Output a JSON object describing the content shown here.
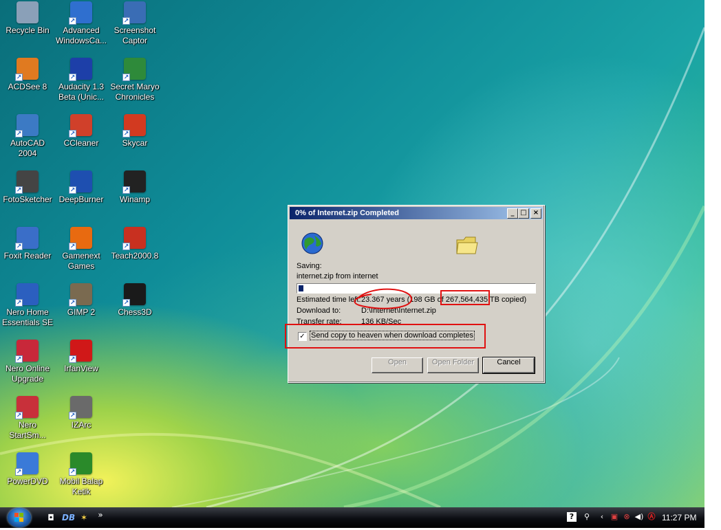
{
  "desktop_icons": [
    {
      "label": "Recycle Bin",
      "icon": "recycle-bin-icon",
      "color": "#8aa0b8"
    },
    {
      "label": "Advanced WindowsCa...",
      "icon": "advanced-windowscare-icon",
      "color": "#2f6fcf"
    },
    {
      "label": "Screenshot Captor",
      "icon": "screenshot-captor-icon",
      "color": "#3a6db5"
    },
    {
      "label": "ACDSee 8",
      "icon": "acdsee-icon",
      "color": "#e07a20"
    },
    {
      "label": "Audacity 1.3 Beta (Unic...",
      "icon": "audacity-icon",
      "color": "#1d3fa8"
    },
    {
      "label": "Secret Maryo Chronicles",
      "icon": "secret-maryo-icon",
      "color": "#2e8a3a"
    },
    {
      "label": "AutoCAD 2004",
      "icon": "autocad-icon",
      "color": "#3c7ac4"
    },
    {
      "label": "CCleaner",
      "icon": "ccleaner-icon",
      "color": "#d0402a"
    },
    {
      "label": "Skycar",
      "icon": "skycar-icon",
      "color": "#d23a20"
    },
    {
      "label": "FotoSketcher",
      "icon": "fotosketcher-icon",
      "color": "#444444"
    },
    {
      "label": "DeepBurner",
      "icon": "deepburner-icon",
      "color": "#1e4fb0"
    },
    {
      "label": "Winamp",
      "icon": "winamp-icon",
      "color": "#222222"
    },
    {
      "label": "Foxit Reader",
      "icon": "foxit-reader-icon",
      "color": "#3a6ec8"
    },
    {
      "label": "Gamenext Games",
      "icon": "gamenext-icon",
      "color": "#e86a10"
    },
    {
      "label": "Teach2000.8",
      "icon": "teach2000-icon",
      "color": "#c83020"
    },
    {
      "label": "Nero Home Essentials SE",
      "icon": "nero-home-icon",
      "color": "#2b5fbf"
    },
    {
      "label": "GIMP 2",
      "icon": "gimp-icon",
      "color": "#7a6a50"
    },
    {
      "label": "Chess3D",
      "icon": "chess3d-icon",
      "color": "#1a1a1a"
    },
    {
      "label": "Nero Online Upgrade",
      "icon": "nero-upgrade-icon",
      "color": "#c8283a"
    },
    {
      "label": "IrfanView",
      "icon": "irfanview-icon",
      "color": "#d01818"
    },
    {
      "label": "",
      "icon": "blank-icon",
      "color": "#00000000"
    },
    {
      "label": "Nero StartSm...",
      "icon": "nero-startsmart-icon",
      "color": "#c8303a"
    },
    {
      "label": "IZArc",
      "icon": "izarc-icon",
      "color": "#6a6a6a"
    },
    {
      "label": "",
      "icon": "blank-icon",
      "color": "#00000000"
    },
    {
      "label": "PowerDVD",
      "icon": "powerdvd-icon",
      "color": "#3a7ad8"
    },
    {
      "label": "Mobil Balap Ketik",
      "icon": "mobil-balap-icon",
      "color": "#2a8a2a"
    }
  ],
  "dialog": {
    "title": "0% of Internet.zip Completed",
    "minimize": "_",
    "maximize": "□",
    "close": "×",
    "globe_icon": "globe-icon",
    "folder_icon": "folder-icon",
    "saving_label": "Saving:",
    "saving_value": "internet.zip from internet",
    "progress": 0.02,
    "estimated_label": "Estimated time left:",
    "estimated_value": "23.367 years (198 GB of 267,564,435 TB copied)",
    "download_to_label": "Download to:",
    "download_to_value": "D:\\Internet\\Internet.zip",
    "transfer_rate_label": "Transfer rate:",
    "transfer_rate_value": "136 KB/Sec",
    "checkbox_label": "Send copy to heaven when download completes",
    "checkbox_checked": true,
    "buttons": {
      "open": "Open",
      "open_folder": "Open Folder",
      "cancel": "Cancel"
    }
  },
  "annotation_color": "#e01010",
  "taskbar": {
    "quick_launch": [
      "camera-icon",
      "deepburner-icon",
      "star-icon"
    ],
    "more": "»",
    "tray_icons": [
      "help-icon",
      "network-icon",
      "chevron-left-icon",
      "monitor-icon",
      "shield-icon",
      "volume-icon",
      "antivirus-icon"
    ],
    "clock": "11:27 PM"
  }
}
